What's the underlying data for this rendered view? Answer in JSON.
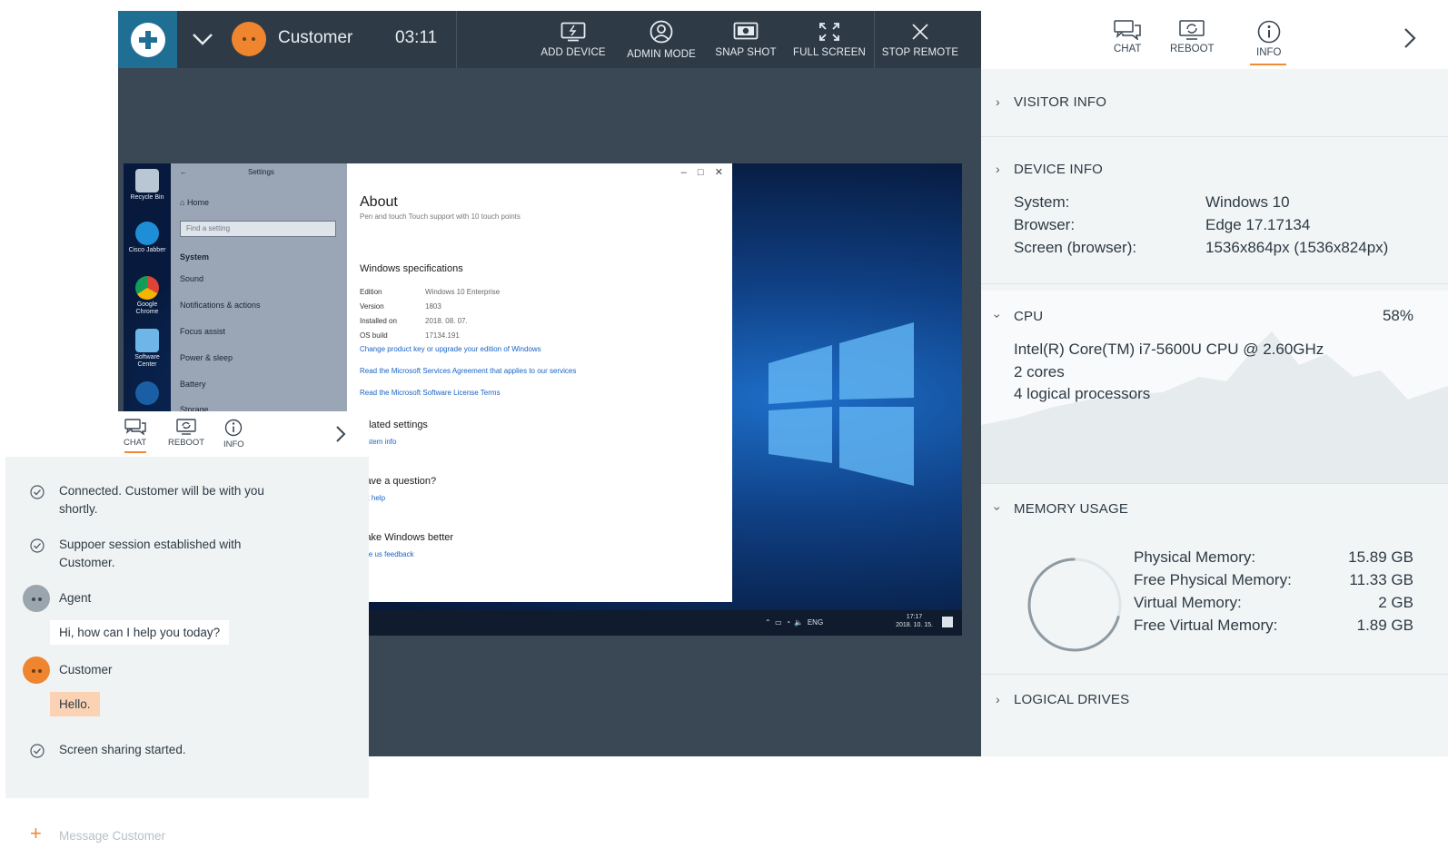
{
  "session": {
    "customer_name": "Customer",
    "timer": "03:11",
    "toolbar": [
      {
        "label": "ADD DEVICE",
        "icon": "add-device-icon"
      },
      {
        "label": "ADMIN MODE",
        "icon": "admin-mode-icon"
      },
      {
        "label": "SNAP SHOT",
        "icon": "camera-icon"
      },
      {
        "label": "FULL SCREEN",
        "icon": "fullscreen-icon"
      },
      {
        "label": "STOP REMOTE",
        "icon": "close-icon"
      }
    ]
  },
  "remote_screen": {
    "desktop_icons": [
      "Recycle Bin",
      "Cisco Jabber",
      "Google Chrome",
      "Software Center"
    ],
    "settings": {
      "title": "Settings",
      "home": "Home",
      "search_placeholder": "Find a setting",
      "group": "System",
      "items": [
        "Sound",
        "Notifications & actions",
        "Focus assist",
        "Power & sleep",
        "Battery",
        "Storage"
      ]
    },
    "about": {
      "title": "About",
      "pen_row": "Pen and touch     Touch support with 10 touch points",
      "spec_heading": "Windows specifications",
      "specs": [
        {
          "k": "Edition",
          "v": "Windows 10 Enterprise"
        },
        {
          "k": "Version",
          "v": "1803"
        },
        {
          "k": "Installed on",
          "v": "2018. 08. 07."
        },
        {
          "k": "OS build",
          "v": "17134.191"
        }
      ],
      "link1": "Change product key or upgrade your edition of Windows",
      "link2": "Read the Microsoft Services Agreement that applies to our services",
      "link3": "Read the Microsoft Software License Terms",
      "related": "elated settings",
      "related_link": "ystem info",
      "question": "lave a question?",
      "question_link": "et help",
      "better": "lake Windows better",
      "better_link": "ive us feedback"
    },
    "taskbar": {
      "lang": "ENG",
      "time": "17:17",
      "date": "2018. 10. 15."
    }
  },
  "chat": {
    "tabs": [
      {
        "label": "CHAT",
        "icon": "chat-icon"
      },
      {
        "label": "REBOOT",
        "icon": "reboot-icon"
      },
      {
        "label": "INFO",
        "icon": "info-icon"
      }
    ],
    "messages": [
      {
        "type": "system",
        "text": "Connected. Customer will be with you shortly."
      },
      {
        "type": "system",
        "text": "Suppoer session established with Customer."
      },
      {
        "type": "sender",
        "name": "Agent"
      },
      {
        "type": "bubble",
        "text": "Hi, how can I help you today?",
        "bg": "#ffffff"
      },
      {
        "type": "sender",
        "name": "Customer"
      },
      {
        "type": "bubble",
        "text": "Hello.",
        "bg": "#fbd3b4"
      },
      {
        "type": "system",
        "text": "Screen sharing started."
      }
    ],
    "input_placeholder": "Message Customer"
  },
  "info": {
    "tabs": [
      {
        "label": "CHAT",
        "icon": "chat-icon"
      },
      {
        "label": "REBOOT",
        "icon": "reboot-icon"
      },
      {
        "label": "INFO",
        "icon": "info-icon"
      }
    ],
    "visitor_info": "VISITOR INFO",
    "device_info": {
      "title": "DEVICE INFO",
      "rows": [
        {
          "k": "System:",
          "v": "Windows 10"
        },
        {
          "k": "Browser:",
          "v": "Edge 17.17134"
        },
        {
          "k": "Screen (browser):",
          "v": "1536x864px (1536x824px)"
        }
      ]
    },
    "cpu": {
      "title": "CPU",
      "percent": "58%",
      "lines": [
        "Intel(R) Core(TM) i7-5600U CPU @ 2.60GHz",
        "2 cores",
        "4 logical processors"
      ]
    },
    "memory": {
      "title": "MEMORY USAGE",
      "used_fraction": 0.29,
      "rows": [
        {
          "k": "Physical Memory:",
          "v": "15.89 GB"
        },
        {
          "k": "Free Physical Memory:",
          "v": "11.33 GB"
        },
        {
          "k": "Virtual Memory:",
          "v": "2 GB"
        },
        {
          "k": "Free Virtual Memory:",
          "v": "1.89 GB"
        }
      ]
    },
    "logical_drives": "LOGICAL DRIVES"
  },
  "colors": {
    "accent": "#f08a35",
    "header": "#2e3a46",
    "brand": "#1f6f95"
  }
}
